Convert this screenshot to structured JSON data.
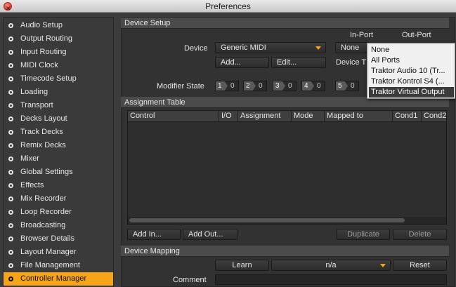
{
  "window": {
    "title": "Preferences"
  },
  "sidebar": {
    "items": [
      {
        "label": "Audio Setup"
      },
      {
        "label": "Output Routing"
      },
      {
        "label": "Input Routing"
      },
      {
        "label": "MIDI Clock"
      },
      {
        "label": "Timecode Setup"
      },
      {
        "label": "Loading"
      },
      {
        "label": "Transport"
      },
      {
        "label": "Decks Layout"
      },
      {
        "label": "Track Decks"
      },
      {
        "label": "Remix Decks"
      },
      {
        "label": "Mixer"
      },
      {
        "label": "Global Settings"
      },
      {
        "label": "Effects"
      },
      {
        "label": "Mix Recorder"
      },
      {
        "label": "Loop Recorder"
      },
      {
        "label": "Broadcasting"
      },
      {
        "label": "Browser Details"
      },
      {
        "label": "Layout Manager"
      },
      {
        "label": "File Management"
      },
      {
        "label": "Controller Manager",
        "active": true
      }
    ]
  },
  "device_setup": {
    "title": "Device Setup",
    "in_port_label": "In-Port",
    "out_port_label": "Out-Port",
    "device_label": "Device",
    "device_value": "Generic MIDI",
    "in_port_value": "None",
    "add_label": "Add...",
    "edit_label": "Edit...",
    "device_target_label": "Device T",
    "modifier_label": "Modifier State",
    "modifiers": [
      {
        "key": "1",
        "value": "0"
      },
      {
        "key": "2",
        "value": "0"
      },
      {
        "key": "3",
        "value": "0"
      },
      {
        "key": "4",
        "value": "0"
      },
      {
        "key": "5",
        "value": "0"
      }
    ]
  },
  "port_dropdown": {
    "options": [
      "None",
      "All Ports",
      "Traktor Audio 10 (Tr...",
      "Traktor Kontrol S4 (...",
      "Traktor Virtual Output"
    ],
    "selected": "Traktor Virtual Output"
  },
  "assignment_table": {
    "title": "Assignment Table",
    "columns": [
      "Control",
      "I/O",
      "Assignment",
      "Mode",
      "Mapped to",
      "Cond1",
      "Cond2"
    ],
    "rows": [],
    "add_in_label": "Add In...",
    "add_out_label": "Add Out...",
    "duplicate_label": "Duplicate",
    "delete_label": "Delete"
  },
  "device_mapping": {
    "title": "Device Mapping",
    "learn_label": "Learn",
    "mapping_value": "n/a",
    "reset_label": "Reset",
    "comment_label": "Comment",
    "comment_value": ""
  },
  "colors": {
    "accent": "#f7a416",
    "background": "#323232",
    "selection": "#3b3b3b"
  }
}
